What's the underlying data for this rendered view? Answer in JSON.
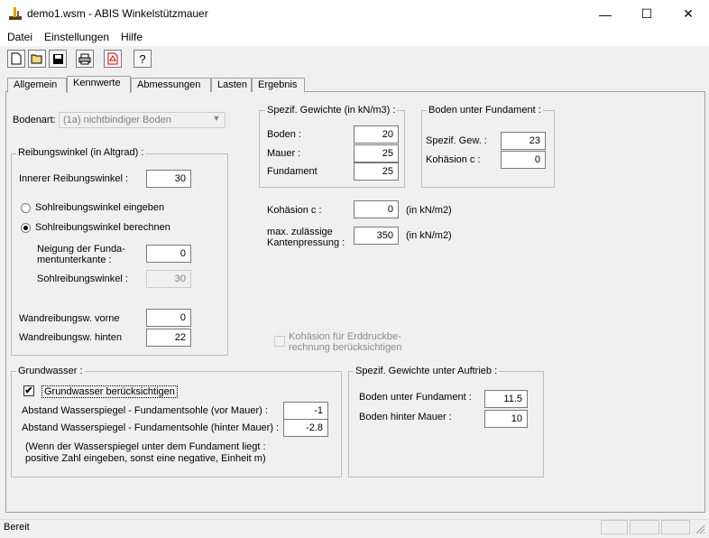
{
  "window": {
    "title": "demo1.wsm - ABIS Winkelstützmauer",
    "minimize": "—",
    "maximize": "☐",
    "close": "✕"
  },
  "menu": {
    "items": [
      "Datei",
      "Einstellungen",
      "Hilfe"
    ]
  },
  "toolbar": {
    "icons": [
      "new-file-icon",
      "open-folder-icon",
      "save-icon",
      "print-icon",
      "pdf-icon",
      "help-icon"
    ],
    "help_glyph": "?"
  },
  "tabs": [
    "Allgemein",
    "Kennwerte",
    "Abmessungen",
    "Lasten",
    "Ergebnis"
  ],
  "active_tab": "Kennwerte",
  "bodenart": {
    "label": "Bodenart:",
    "value": "(1a) nichtbindiger Boden"
  },
  "reibung": {
    "title": "Reibungswinkel (in Altgrad) :",
    "innerer_label": "Innerer Reibungswinkel :",
    "innerer_value": "30",
    "radio1": "Sohlreibungswinkel eingeben",
    "radio2": "Sohlreibungswinkel berechnen",
    "neigung_label1": "Neigung der Funda-",
    "neigung_label2": "mentunterkante :",
    "neigung_value": "0",
    "sohl_label": "Sohlreibungswinkel :",
    "sohl_value": "30",
    "vorne_label": "Wandreibungsw. vorne",
    "vorne_value": "0",
    "hinten_label": "Wandreibungsw. hinten",
    "hinten_value": "22"
  },
  "gewichte": {
    "title": "Spezif. Gewichte (in kN/m3) :",
    "boden_label": "Boden :",
    "boden_value": "20",
    "mauer_label": "Mauer :",
    "mauer_value": "25",
    "fundament_label": "Fundament",
    "fundament_value": "25"
  },
  "unter_fundament": {
    "title": "Boden unter Fundament :",
    "gew_label": "Spezif. Gew. :",
    "gew_value": "23",
    "kohaesion_label": "Kohäsion c :",
    "kohaesion_value": "0"
  },
  "kohaesion": {
    "label": "Kohäsion c  :",
    "value": "0",
    "unit": "(in kN/m2)"
  },
  "kantenpressung": {
    "label1": "max. zulässige",
    "label2": "Kantenpressung :",
    "value": "350",
    "unit": "(in kN/m2)"
  },
  "erddruck_check": {
    "label1": "Kohäsion für Erddruckbe-",
    "label2": "rechnung berücksichtigen",
    "checked": false
  },
  "grundwasser": {
    "title": "Grundwasser :",
    "check_label": "Grundwasser berücksichtigen",
    "checked": true,
    "check_glyph": "✔",
    "vor_label": "Abstand Wasserspiegel - Fundamentsohle (vor Mauer) :",
    "vor_value": "-1",
    "hinter_label": "Abstand Wasserspiegel - Fundamentsohle (hinter Mauer) :",
    "hinter_value": "-2.8",
    "note1": "(Wenn der Wasserspiegel unter dem Fundament liegt :",
    "note2": "positive Zahl eingeben, sonst eine negative, Einheit m)"
  },
  "auftrieb": {
    "title": "Spezif. Gewichte unter Auftrieb :",
    "unter_label": "Boden unter Fundament :",
    "unter_value": "11.5",
    "hinter_label": "Boden hinter Mauer :",
    "hinter_value": "10"
  },
  "status": {
    "text": "Bereit"
  }
}
